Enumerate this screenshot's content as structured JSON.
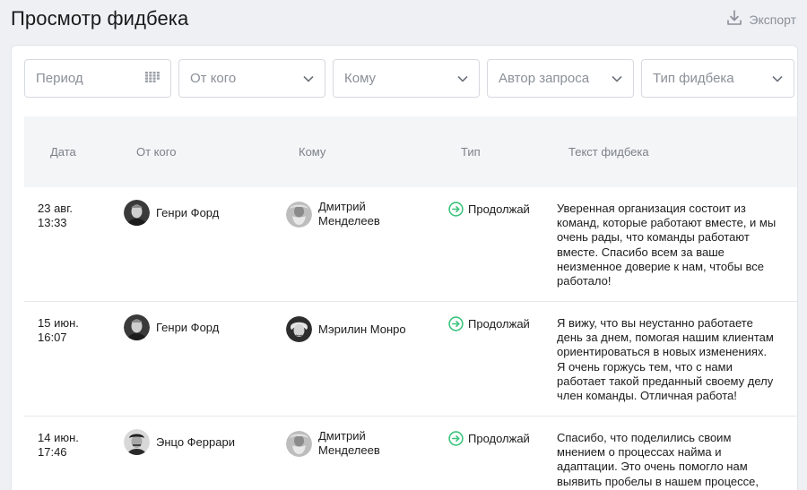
{
  "header": {
    "title": "Просмотр фидбека",
    "export_label": "Экспорт"
  },
  "filters": {
    "period": "Период",
    "from": "От кого",
    "to": "Кому",
    "author": "Автор запроса",
    "type": "Тип фидбека"
  },
  "table": {
    "columns": {
      "date": "Дата",
      "from": "От кого",
      "to": "Кому",
      "type": "Тип",
      "text": "Текст фидбека"
    },
    "rows": [
      {
        "date_day": "23 авг.",
        "date_time": "13:33",
        "from": "Генри Форд",
        "to_line1": "Дмитрий",
        "to_line2": "Менделеев",
        "type": "Продолжай",
        "text": "Уверенная организация состоит из команд, которые работают вместе, и мы очень рады, что команды работают вместе. Спасибо всем за ваше неизменное доверие к нам, чтобы все работало!"
      },
      {
        "date_day": "15 июн.",
        "date_time": "16:07",
        "from": "Генри Форд",
        "to": "Мэрилин Монро",
        "type": "Продолжай",
        "text": "Я вижу, что вы неустанно работаете день за днем, помогая нашим клиентам ориентироваться в новых изменениях. Я очень горжусь тем, что с нами работает такой преданный своему делу член команды. Отличная работа!"
      },
      {
        "date_day": "14 июн.",
        "date_time": "17:46",
        "from": "Энцо Феррари",
        "to_line1": "Дмитрий",
        "to_line2": "Менделеев",
        "type": "Продолжай",
        "text": "Спасибо, что поделились своим мнением о процессах найма и адаптации. Это очень помогло нам выявить пробелы в нашем процессе,"
      }
    ]
  },
  "colors": {
    "background": "#eef0f4",
    "card": "#ffffff",
    "accent_continue": "#3cc47c",
    "muted_text": "#8b8f97"
  },
  "icons": {
    "export": "download-icon",
    "period": "calendar-grid-icon",
    "dropdown": "chevron-down-icon",
    "type_continue": "arrow-right-circle-icon"
  }
}
